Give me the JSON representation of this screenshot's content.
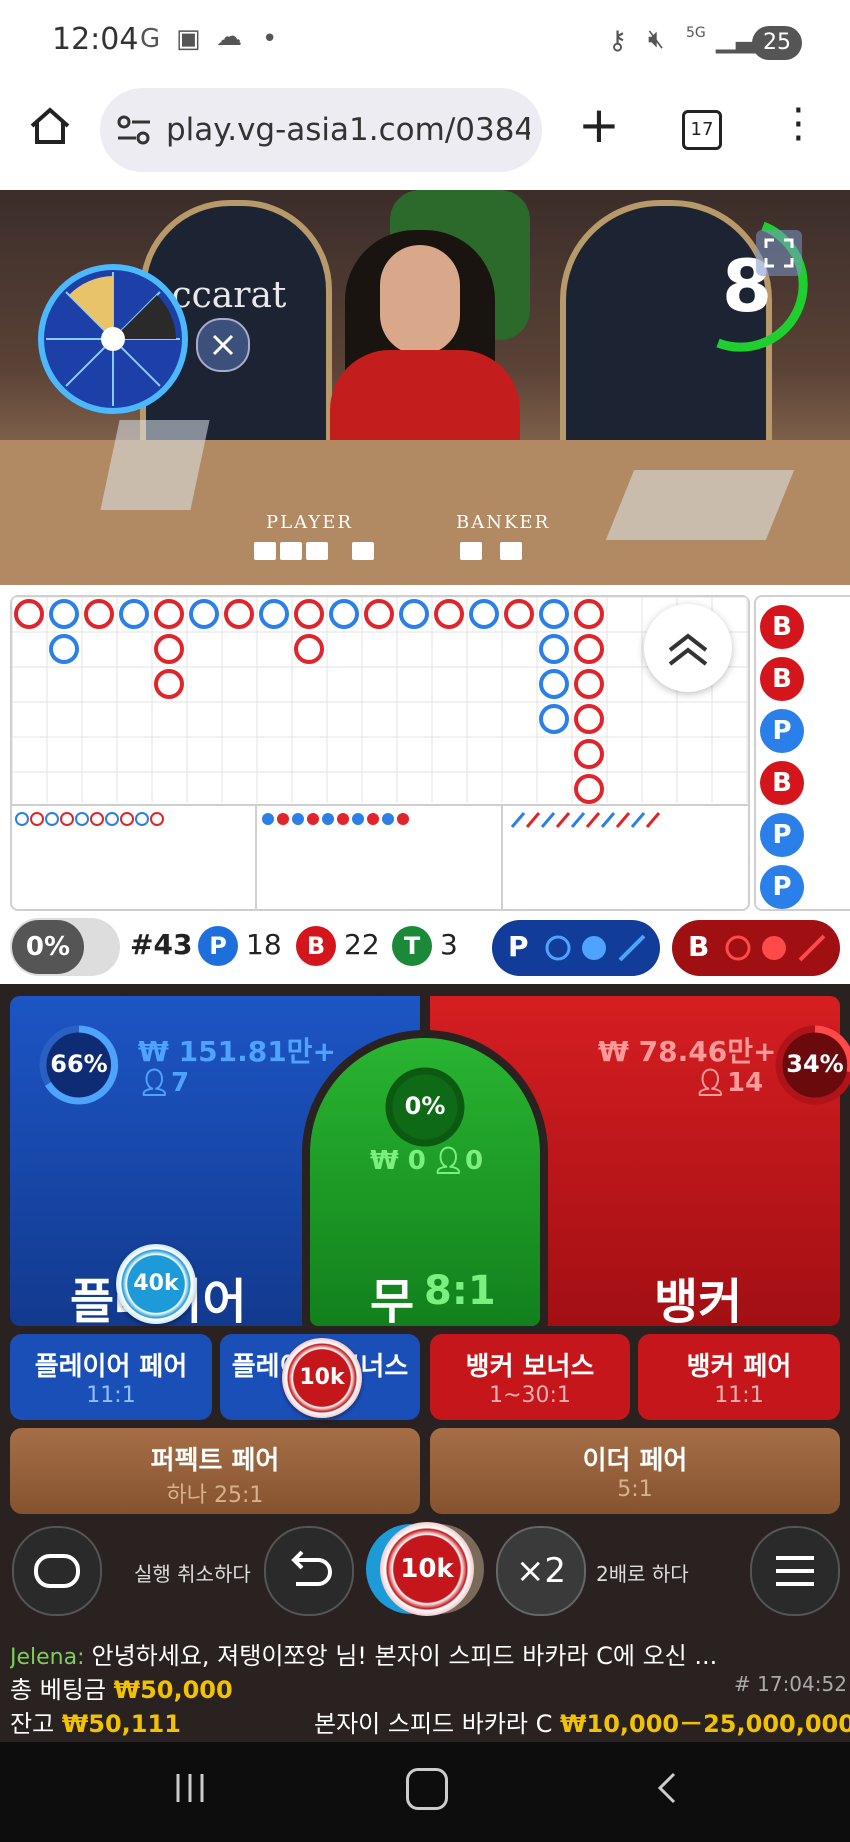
{
  "status_bar": {
    "time": "12:04",
    "battery": "25",
    "network": "5G"
  },
  "browser": {
    "url": "play.vg-asia1.com/03848",
    "tab_count": "17"
  },
  "video": {
    "countdown": "8",
    "table_labels": {
      "player": "PLAYER",
      "banker": "BANKER"
    },
    "logo_text": "accarat"
  },
  "roadmap_side": [
    "B",
    "B",
    "P",
    "B",
    "P",
    "P"
  ],
  "stats": {
    "percent": "0%",
    "round": "#43",
    "player_count": "18",
    "banker_count": "22",
    "tie_count": "3",
    "p_label": "P",
    "b_label": "B",
    "t_label": "T",
    "p_predict": "P",
    "b_predict": "B"
  },
  "player_panel": {
    "percent": "66%",
    "amount": "₩ 151.81만+",
    "bettors": "7",
    "label": "플레이어"
  },
  "tie_panel": {
    "percent": "0%",
    "amount": "₩ 0",
    "bettors": "0",
    "label": "무",
    "odds": "8:1"
  },
  "banker_panel": {
    "percent": "34%",
    "amount": "₩ 78.46만+",
    "bettors": "14",
    "label": "뱅커"
  },
  "chips": {
    "player_chip": "40k",
    "bonus_chip": "10k",
    "selected_chip": "10k"
  },
  "side_bets": [
    {
      "label": "플레이어 페어",
      "odds": "11:1"
    },
    {
      "label": "플레이어 보너스",
      "odds": ""
    },
    {
      "label": "뱅커 보너스",
      "odds": "1~30:1"
    },
    {
      "label": "뱅커 페어",
      "odds": "11:1"
    }
  ],
  "extra_bets": [
    {
      "label": "퍼펙트 페어",
      "odds": "하나 25:1"
    },
    {
      "label": "이더 페어",
      "odds": "5:1"
    }
  ],
  "controls": {
    "undo_label": "실행 취소하다",
    "double_label": "2배로 하다",
    "double_btn": "×2"
  },
  "chat": {
    "user": "Jelena:",
    "message": "안녕하세요, 져탱이쪼앙 님! 본자이 스피드 바카라 C에 오신 ..."
  },
  "footer": {
    "total_bet_label": "총 베팅금",
    "total_bet": "₩50,000",
    "round_id": "# 17:04:52",
    "balance_label": "잔고",
    "balance": "₩50,111",
    "table_name": "본자이 스피드 바카라 C",
    "limits": "₩10,000－25,000,000"
  },
  "colors": {
    "player_blue": "#1a4fb5",
    "banker_red": "#c0161b",
    "tie_green": "#1c9a2b",
    "gold": "#f2c200"
  }
}
